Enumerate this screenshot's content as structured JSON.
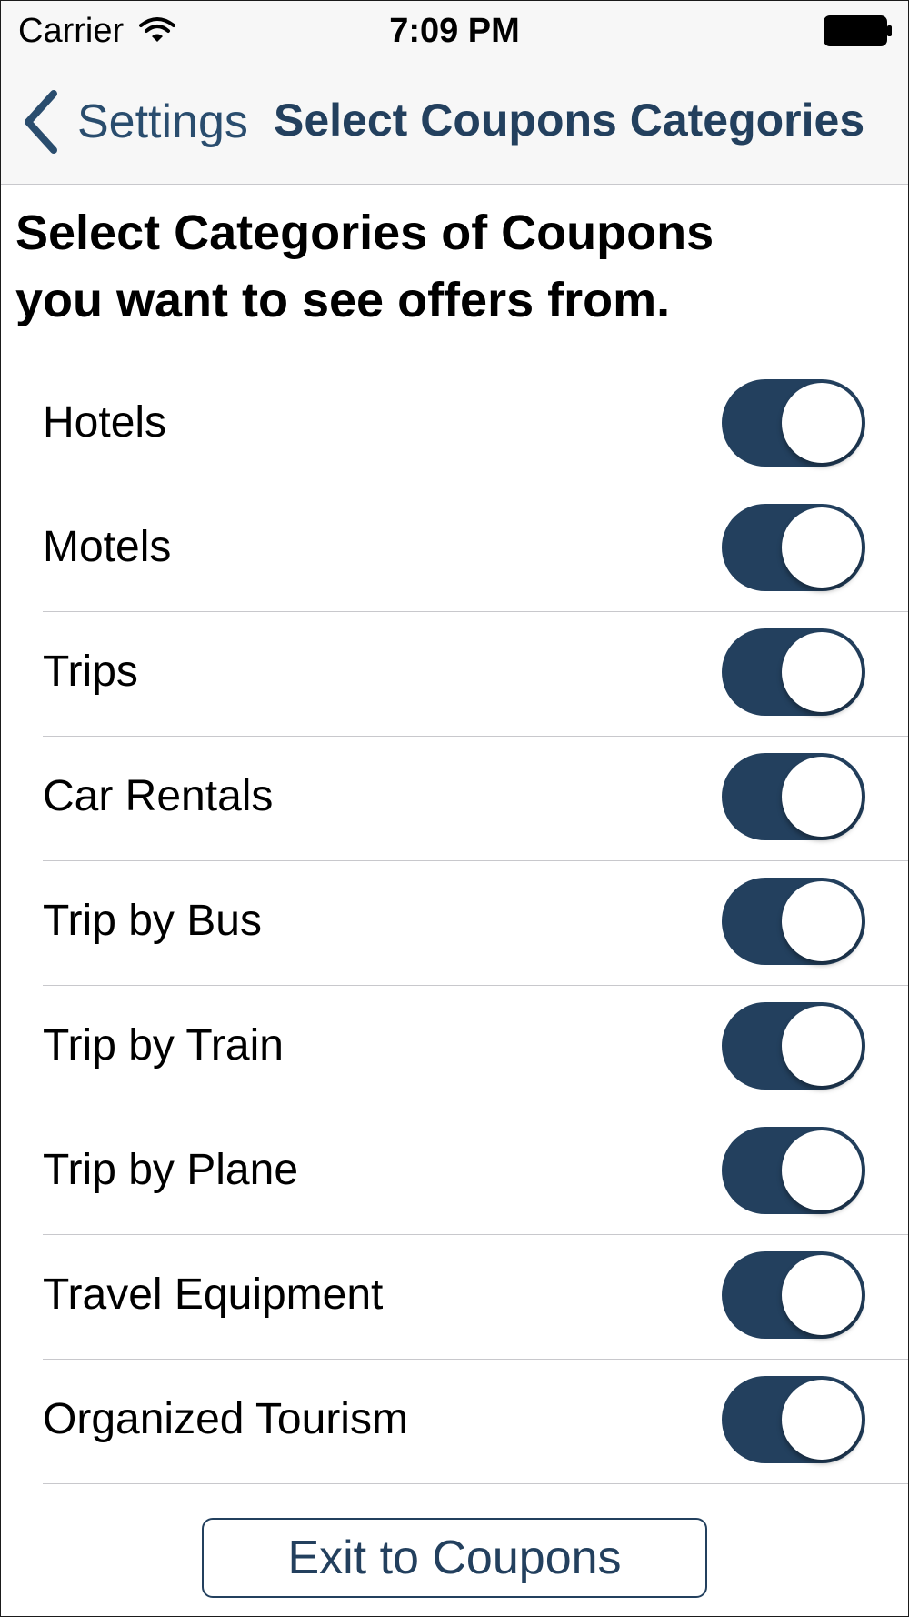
{
  "status_bar": {
    "carrier": "Carrier",
    "time": "7:09 PM",
    "wifi_icon": "wifi-icon",
    "battery_icon": "battery-icon"
  },
  "nav_bar": {
    "back_label": "Settings",
    "back_icon": "chevron-left-icon",
    "title": "Select Coupons Categories"
  },
  "heading": {
    "line1": "Select Categories of Coupons",
    "line2": "you want to see offers from."
  },
  "categories": [
    {
      "label": "Hotels",
      "enabled": true
    },
    {
      "label": "Motels",
      "enabled": true
    },
    {
      "label": "Trips",
      "enabled": true
    },
    {
      "label": "Car Rentals",
      "enabled": true
    },
    {
      "label": "Trip by Bus",
      "enabled": true
    },
    {
      "label": "Trip by Train",
      "enabled": true
    },
    {
      "label": "Trip by Plane",
      "enabled": true
    },
    {
      "label": "Travel Equipment",
      "enabled": true
    },
    {
      "label": "Organized Tourism",
      "enabled": true
    }
  ],
  "exit_button": {
    "label": "Exit to Coupons"
  },
  "colors": {
    "accent": "#23405e",
    "nav_background": "#f7f7f7",
    "separator": "#c8c8cc"
  }
}
